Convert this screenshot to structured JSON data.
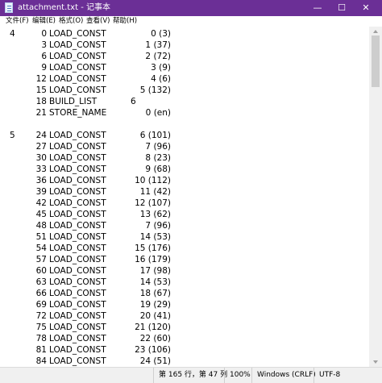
{
  "window": {
    "title": "attachment.txt - 记事本",
    "controls": {
      "minimize": "—",
      "maximize": "☐",
      "close": "✕"
    },
    "title_color": "#6b2f96"
  },
  "menu": [
    "文件(F)",
    "编辑(E)",
    "格式(O)",
    "查看(V)",
    "帮助(H)"
  ],
  "editor": {
    "lines": [
      {
        "line_no": "4",
        "offset": "0",
        "op": "LOAD_CONST",
        "arg": "0 (3)"
      },
      {
        "line_no": "",
        "offset": "3",
        "op": "LOAD_CONST",
        "arg": "1 (37)"
      },
      {
        "line_no": "",
        "offset": "6",
        "op": "LOAD_CONST",
        "arg": "2 (72)"
      },
      {
        "line_no": "",
        "offset": "9",
        "op": "LOAD_CONST",
        "arg": "3 (9)"
      },
      {
        "line_no": "",
        "offset": "12",
        "op": "LOAD_CONST",
        "arg": "4 (6)"
      },
      {
        "line_no": "",
        "offset": "15",
        "op": "LOAD_CONST",
        "arg": "5 (132)"
      },
      {
        "line_no": "",
        "offset": "18",
        "op": "BUILD_LIST",
        "arg": "6"
      },
      {
        "line_no": "",
        "offset": "21",
        "op": "STORE_NAME",
        "arg": "0 (en)"
      },
      {
        "line_no": "",
        "offset": "",
        "op": "",
        "arg": ""
      },
      {
        "line_no": "5",
        "offset": "24",
        "op": "LOAD_CONST",
        "arg": "6 (101)"
      },
      {
        "line_no": "",
        "offset": "27",
        "op": "LOAD_CONST",
        "arg": "7 (96)"
      },
      {
        "line_no": "",
        "offset": "30",
        "op": "LOAD_CONST",
        "arg": "8 (23)"
      },
      {
        "line_no": "",
        "offset": "33",
        "op": "LOAD_CONST",
        "arg": "9 (68)"
      },
      {
        "line_no": "",
        "offset": "36",
        "op": "LOAD_CONST",
        "arg": "10 (112)"
      },
      {
        "line_no": "",
        "offset": "39",
        "op": "LOAD_CONST",
        "arg": "11 (42)"
      },
      {
        "line_no": "",
        "offset": "42",
        "op": "LOAD_CONST",
        "arg": "12 (107)"
      },
      {
        "line_no": "",
        "offset": "45",
        "op": "LOAD_CONST",
        "arg": "13 (62)"
      },
      {
        "line_no": "",
        "offset": "48",
        "op": "LOAD_CONST",
        "arg": "7 (96)"
      },
      {
        "line_no": "",
        "offset": "51",
        "op": "LOAD_CONST",
        "arg": "14 (53)"
      },
      {
        "line_no": "",
        "offset": "54",
        "op": "LOAD_CONST",
        "arg": "15 (176)"
      },
      {
        "line_no": "",
        "offset": "57",
        "op": "LOAD_CONST",
        "arg": "16 (179)"
      },
      {
        "line_no": "",
        "offset": "60",
        "op": "LOAD_CONST",
        "arg": "17 (98)"
      },
      {
        "line_no": "",
        "offset": "63",
        "op": "LOAD_CONST",
        "arg": "14 (53)"
      },
      {
        "line_no": "",
        "offset": "66",
        "op": "LOAD_CONST",
        "arg": "18 (67)"
      },
      {
        "line_no": "",
        "offset": "69",
        "op": "LOAD_CONST",
        "arg": "19 (29)"
      },
      {
        "line_no": "",
        "offset": "72",
        "op": "LOAD_CONST",
        "arg": "20 (41)"
      },
      {
        "line_no": "",
        "offset": "75",
        "op": "LOAD_CONST",
        "arg": "21 (120)"
      },
      {
        "line_no": "",
        "offset": "78",
        "op": "LOAD_CONST",
        "arg": "22 (60)"
      },
      {
        "line_no": "",
        "offset": "81",
        "op": "LOAD_CONST",
        "arg": "23 (106)"
      },
      {
        "line_no": "",
        "offset": "84",
        "op": "LOAD_CONST",
        "arg": "24 (51)"
      }
    ]
  },
  "status": {
    "position": "第 165 行，第 47 列",
    "zoom": "100%",
    "line_ending": "Windows (CRLF)",
    "encoding": "UTF-8"
  }
}
